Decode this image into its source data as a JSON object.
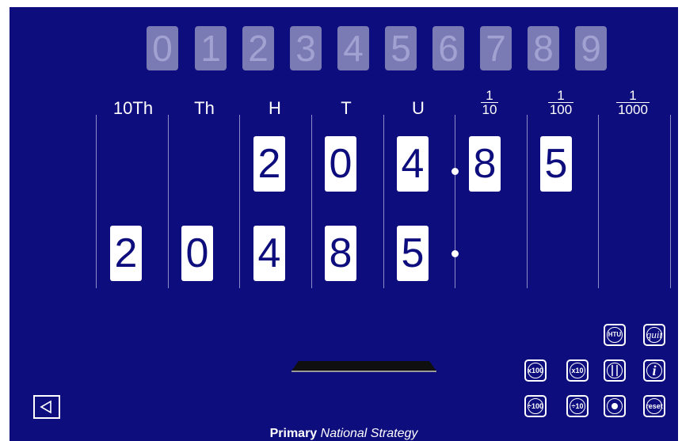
{
  "palette": [
    "0",
    "1",
    "2",
    "3",
    "4",
    "5",
    "6",
    "7",
    "8",
    "9"
  ],
  "headers": {
    "ten_thousands": "10Th",
    "thousands": "Th",
    "hundreds": "H",
    "tens": "T",
    "units": "U",
    "tenths": {
      "num": "1",
      "den": "10"
    },
    "hundredths": {
      "num": "1",
      "den": "100"
    },
    "thousandths": {
      "num": "1",
      "den": "1000"
    }
  },
  "top_row": {
    "hundreds": "2",
    "tens": "0",
    "units": "4",
    "tenths": "8",
    "hundredths": "5"
  },
  "bottom_row": {
    "ten_thousands": "2",
    "thousands": "0",
    "hundreds": "4",
    "tens": "8",
    "units": "5"
  },
  "buttons": {
    "htu": "HTU",
    "quit": "quit",
    "x100": "x100",
    "x10": "x10",
    "columns_icon": "columns-icon",
    "info": "i",
    "div100": "÷100",
    "div10": "÷10",
    "point_icon": "decimal-point-icon",
    "reset": "reset",
    "back_icon": "back-triangle-icon"
  },
  "footer": {
    "brand_bold": "Primary",
    "brand_italic": "National Strategy"
  },
  "colors": {
    "background": "#0d0d7d",
    "palette_tile": "#7a7ab4",
    "card": "#ffffff",
    "text": "#ffffff"
  }
}
